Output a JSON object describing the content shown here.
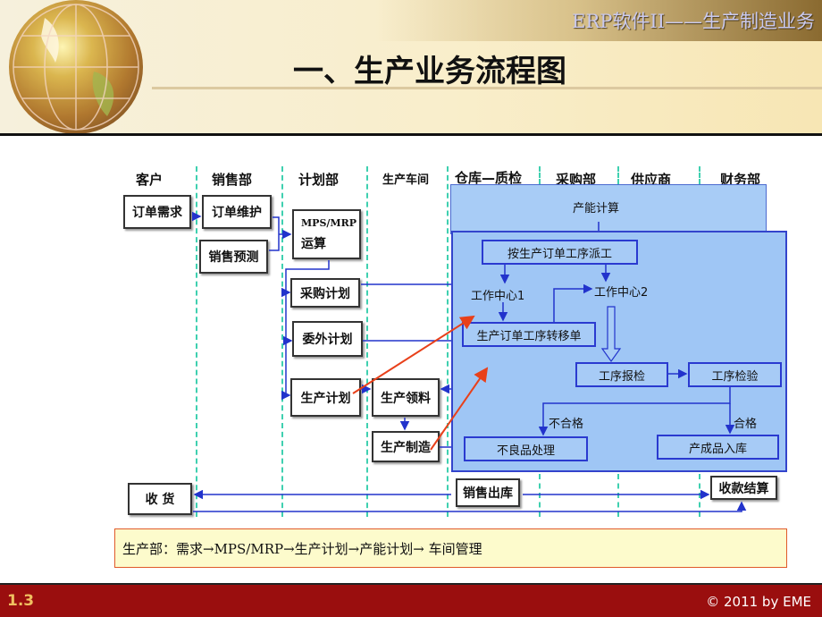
{
  "header": {
    "subtitle": "ERP软件II——生产制造业务",
    "title": "一、生产业务流程图"
  },
  "lanes": [
    "客户",
    "销售部",
    "计划部",
    "生产车间",
    "仓库—质检",
    "采购部",
    "供应商",
    "财务部"
  ],
  "boxes": {
    "order_demand": "订单需求",
    "order_maint": "订单维护",
    "sales_forecast": "销售预测",
    "mps_line1": "MPS/MRP",
    "mps_line2": "运算",
    "purchase_plan": "采购计划",
    "outsource_plan": "委外计划",
    "production_plan": "生产计划",
    "material_issue": "生产领料",
    "manufacturing": "生产制造",
    "receive_goods": "收  货",
    "sales_outbound": "销售出库",
    "payment_settle": "收款结算"
  },
  "workshop": {
    "capacity_calc": "产能计算",
    "dispatch": "按生产订单工序派工",
    "work_center_1": "工作中心1",
    "work_center_2": "工作中心2",
    "transfer_order": "生产订单工序转移单",
    "process_report": "工序报检",
    "process_inspect": "工序检验",
    "unqualified_label": "不合格",
    "qualified_label": "合格",
    "defect_handling": "不良品处理",
    "finished_stock_in": "产成品入库"
  },
  "summary": "生产部：需求→MPS/MRP→生产计划→产能计划→ 车间管理",
  "footer": {
    "page": "1.3",
    "copyright": "© 2011  by EME"
  },
  "colors": {
    "footer_bg": "#9a0e0e",
    "lane_divider": "#3fd0b0",
    "flow_arrow": "#2233cc",
    "highlight_arrow": "#e8401a",
    "panel_fill": "#a8ccf6"
  }
}
